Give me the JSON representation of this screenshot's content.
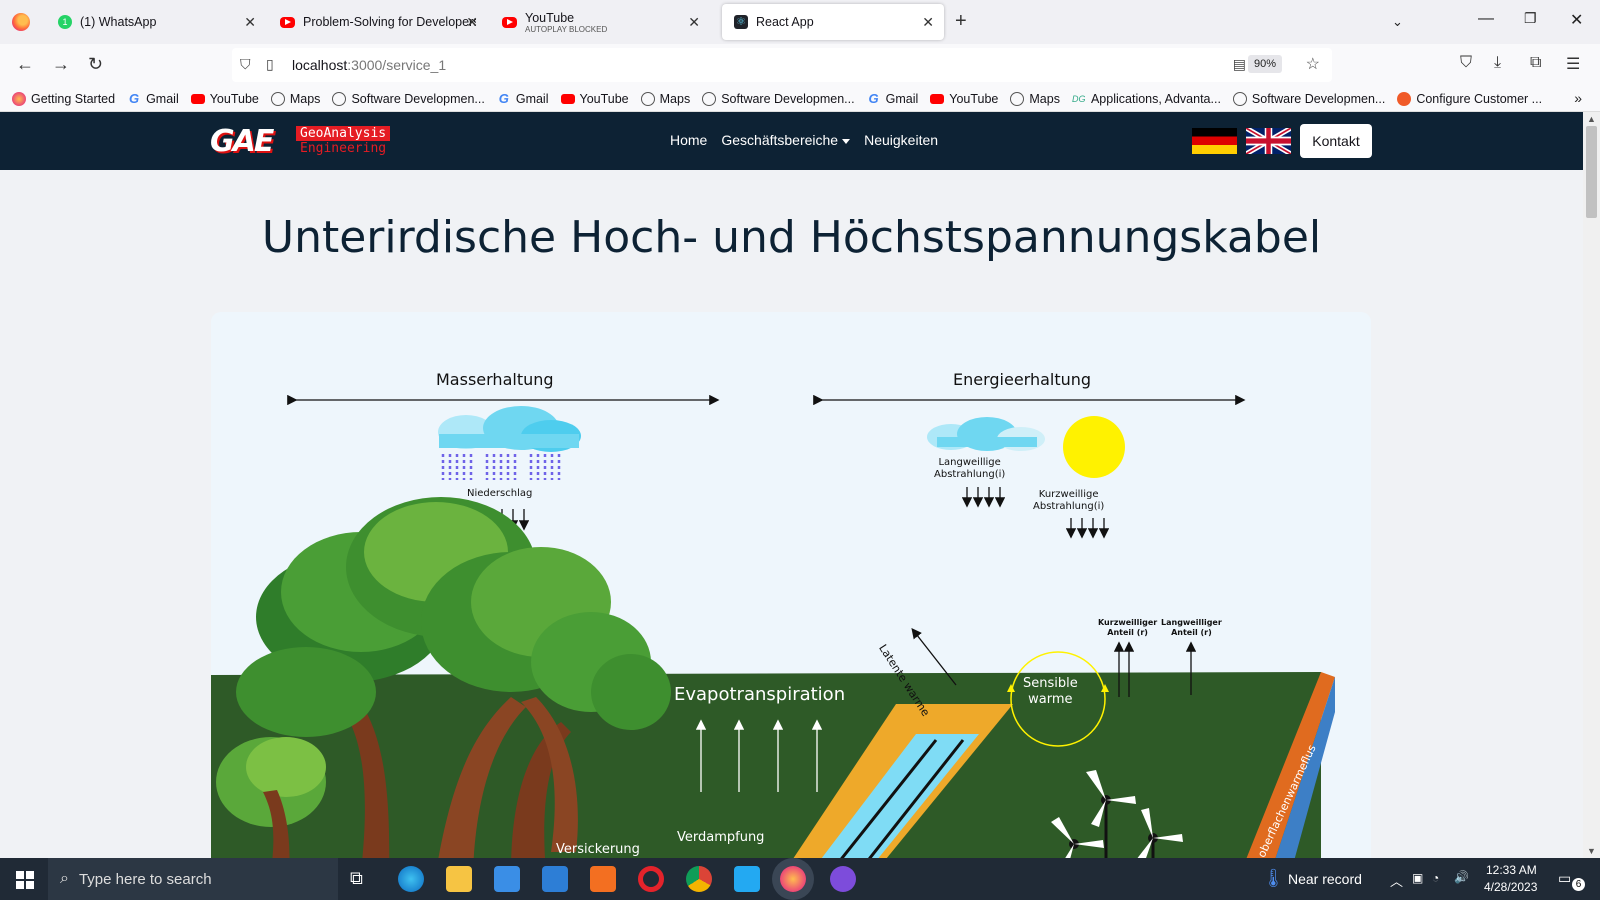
{
  "browser": {
    "tabs": [
      {
        "title": "(1) WhatsApp",
        "icon": "whatsapp-icon"
      },
      {
        "title": "Problem-Solving for Developers",
        "icon": "youtube-icon"
      },
      {
        "title": "YouTube",
        "subtitle": "AUTOPLAY BLOCKED",
        "icon": "youtube-icon"
      },
      {
        "title": "React App",
        "icon": "react-icon",
        "active": true
      }
    ],
    "url_host": "localhost",
    "url_path": ":3000/service_1",
    "zoom": "90%",
    "bookmarks": [
      {
        "label": "Getting Started",
        "icon": "firefox-icon"
      },
      {
        "label": "Gmail",
        "icon": "google-icon"
      },
      {
        "label": "YouTube",
        "icon": "youtube-icon"
      },
      {
        "label": "Maps",
        "icon": "globe-icon"
      },
      {
        "label": "Software Developmen...",
        "icon": "globe-icon"
      },
      {
        "label": "Gmail",
        "icon": "google-icon"
      },
      {
        "label": "YouTube",
        "icon": "youtube-icon"
      },
      {
        "label": "Maps",
        "icon": "globe-icon"
      },
      {
        "label": "Software Developmen...",
        "icon": "globe-icon"
      },
      {
        "label": "Gmail",
        "icon": "google-icon"
      },
      {
        "label": "YouTube",
        "icon": "youtube-icon"
      },
      {
        "label": "Maps",
        "icon": "globe-icon"
      },
      {
        "label": "Applications, Advanta...",
        "icon": "dg-icon"
      },
      {
        "label": "Software Developmen...",
        "icon": "globe-icon"
      },
      {
        "label": "Configure Customer ...",
        "icon": "cc-icon"
      }
    ]
  },
  "site": {
    "logo_main": "GAE",
    "logo_line1": "GeoAnalysis",
    "logo_line2": "Engineering",
    "nav": {
      "home": "Home",
      "business": "Geschäftsbereiche",
      "news": "Neuigkeiten",
      "contact": "Kontakt"
    },
    "title": "Unterirdische Hoch- und Höchstspannungskabel",
    "diagram": {
      "mass": "Masserhaltung",
      "energy": "Energieerhaltung",
      "precip": "Niederschlag",
      "longwave_1": "Langweillige",
      "longwave_2": "Abstrahlung(i)",
      "shortwave_1": "Kurzweillige",
      "shortwave_2": "Abstrahlung(i)",
      "latent": "Latente warme",
      "sensible_1": "Sensible",
      "sensible_2": "warme",
      "kurz_anteil_1": "Kurzweilliger",
      "kurz_anteil_2": "Anteil (r)",
      "lang_anteil_1": "Langweilliger",
      "lang_anteil_2": "Anteil (r)",
      "evapo": "Evapotranspiration",
      "verdampfung": "Verdampfung",
      "versickerung": "Versickerung",
      "oberflaeche": "oberflachenwarmeflus",
      "colors": {
        "ground": "#2e5a27",
        "sun": "#fff200",
        "cable": "#7fdcf5",
        "trench": "#eea92a",
        "side": "#e06b1f"
      }
    }
  },
  "taskbar": {
    "search_placeholder": "Type here to search",
    "weather": "Near record",
    "time": "12:33 AM",
    "date": "4/28/2023",
    "notifications": "6"
  }
}
